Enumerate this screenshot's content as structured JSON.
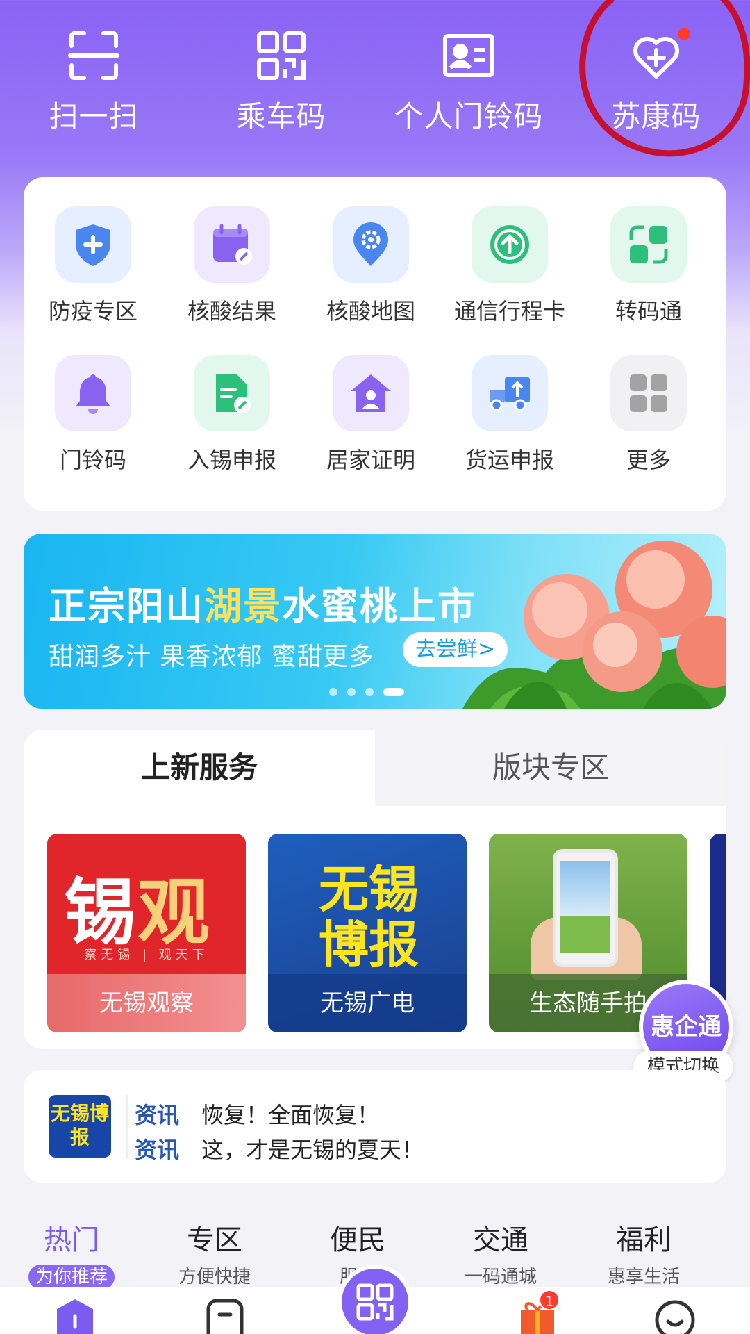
{
  "topbar": {
    "items": [
      {
        "label": "扫一扫",
        "icon": "scan-icon"
      },
      {
        "label": "乘车码",
        "icon": "qr-code-icon"
      },
      {
        "label": "个人门铃码",
        "icon": "id-card-icon"
      },
      {
        "label": "苏康码",
        "icon": "heart-plus-icon"
      }
    ]
  },
  "services": {
    "items": [
      {
        "label": "防疫专区",
        "icon": "shield-plus-icon",
        "color": "#4a86f0"
      },
      {
        "label": "核酸结果",
        "icon": "calendar-edit-icon",
        "color": "#8a62f0"
      },
      {
        "label": "核酸地图",
        "icon": "location-gear-icon",
        "color": "#4a86f0"
      },
      {
        "label": "通信行程卡",
        "icon": "arrow-up-circle-icon",
        "color": "#2cc07b"
      },
      {
        "label": "转码通",
        "icon": "switch-grid-icon",
        "color": "#2cc07b"
      },
      {
        "label": "门铃码",
        "icon": "bell-icon",
        "color": "#8a62f0"
      },
      {
        "label": "入锡申报",
        "icon": "document-edit-icon",
        "color": "#2cc07b"
      },
      {
        "label": "居家证明",
        "icon": "home-user-icon",
        "color": "#8a62f0"
      },
      {
        "label": "货运申报",
        "icon": "truck-icon",
        "color": "#4a86f0"
      },
      {
        "label": "更多",
        "icon": "more-grid-icon",
        "color": "#9a9a9a"
      }
    ]
  },
  "banner": {
    "title_a": "正宗阳山",
    "title_hl": "湖景",
    "title_b": "水蜜桃上市",
    "subtitle": "甜润多汁 果香浓郁 蜜甜更多",
    "button": "去尝鲜>",
    "active_slide": 4,
    "slide_count": 4
  },
  "new_services": {
    "tabs": [
      "上新服务",
      "版块专区"
    ],
    "tiles": [
      {
        "caption": "无锡观察",
        "art_a": "锡",
        "art_b": "观",
        "art_small": "察无锡 | 观天下"
      },
      {
        "caption": "无锡广电",
        "art": "无锡博报"
      },
      {
        "caption": "生态随手拍"
      }
    ]
  },
  "float_button": {
    "label": "惠企通",
    "tag": "模式切换"
  },
  "news": {
    "logo": "无锡博报",
    "items": [
      {
        "tag": "资讯",
        "text": "恢复！全面恢复！"
      },
      {
        "tag": "资讯",
        "text": "这，才是无锡的夏天！"
      }
    ]
  },
  "categories": [
    {
      "title": "热门",
      "sub": "为你推荐"
    },
    {
      "title": "专区",
      "sub": "方便快捷"
    },
    {
      "title": "便民",
      "sub": "服务"
    },
    {
      "title": "交通",
      "sub": "一码通城"
    },
    {
      "title": "福利",
      "sub": "惠享生活"
    }
  ],
  "bottom_nav": {
    "gift_badge": "1"
  }
}
